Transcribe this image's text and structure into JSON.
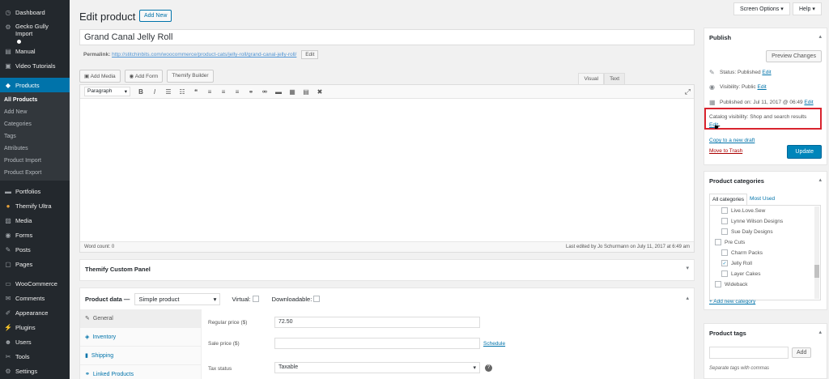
{
  "sidebar": {
    "items": [
      {
        "label": "Dashboard",
        "icon": "dashboard-icon",
        "glyph": "◷"
      },
      {
        "label": "Gecko Gully Import",
        "icon": "gear-icon",
        "glyph": "⚙"
      },
      {
        "label": "Manual",
        "icon": "book-icon",
        "glyph": "▤"
      },
      {
        "label": "Video Tutorials",
        "icon": "video-icon",
        "glyph": "▣"
      },
      {
        "label": "Products",
        "icon": "products-icon",
        "glyph": "◆"
      },
      {
        "label": "Portfolios",
        "icon": "portfolio-icon",
        "glyph": "▬"
      },
      {
        "label": "Themify Ultra",
        "icon": "themify-icon",
        "glyph": "●"
      },
      {
        "label": "Media",
        "icon": "media-icon",
        "glyph": "▨"
      },
      {
        "label": "Forms",
        "icon": "forms-icon",
        "glyph": "◉"
      },
      {
        "label": "Posts",
        "icon": "pin-icon",
        "glyph": "✎"
      },
      {
        "label": "Pages",
        "icon": "pages-icon",
        "glyph": "▢"
      },
      {
        "label": "WooCommerce",
        "icon": "woocommerce-icon",
        "glyph": "▭"
      },
      {
        "label": "Comments",
        "icon": "comments-icon",
        "glyph": "✉"
      },
      {
        "label": "Appearance",
        "icon": "appearance-icon",
        "glyph": "✐"
      },
      {
        "label": "Plugins",
        "icon": "plugins-icon",
        "glyph": "⚡"
      },
      {
        "label": "Users",
        "icon": "users-icon",
        "glyph": "☻"
      },
      {
        "label": "Tools",
        "icon": "tools-icon",
        "glyph": "✂"
      },
      {
        "label": "Settings",
        "icon": "settings-icon",
        "glyph": "⚙"
      }
    ],
    "submenu": [
      "All Products",
      "Add New",
      "Categories",
      "Tags",
      "Attributes",
      "Product Import",
      "Product Export"
    ]
  },
  "header": {
    "title": "Edit product",
    "add_new": "Add New",
    "screen_options": "Screen Options ▾",
    "help": "Help ▾"
  },
  "post": {
    "title": "Grand Canal Jelly Roll",
    "permalink_label": "Permalink:",
    "permalink_url": "http://stitchinbits.com/woocommerce/product-cats/jelly-roll/grand-canal-jelly-roll/",
    "permalink_edit": "Edit"
  },
  "editor": {
    "add_media": "Add Media",
    "add_form": "Add Form",
    "themify_builder": "Themify Builder",
    "tab_visual": "Visual",
    "tab_text": "Text",
    "format": "Paragraph",
    "word_count": "Word count: 0",
    "last_edited": "Last edited by Jo Schurmann on July 11, 2017 at 6:49 am",
    "toolbar_icons": [
      {
        "name": "bold-icon",
        "glyph": "B"
      },
      {
        "name": "italic-icon",
        "glyph": "I"
      },
      {
        "name": "bullet-list-icon",
        "glyph": "☰"
      },
      {
        "name": "numbered-list-icon",
        "glyph": "☷"
      },
      {
        "name": "blockquote-icon",
        "glyph": "❝"
      },
      {
        "name": "align-left-icon",
        "glyph": "≡"
      },
      {
        "name": "align-center-icon",
        "glyph": "≡"
      },
      {
        "name": "align-right-icon",
        "glyph": "≡"
      },
      {
        "name": "link-icon",
        "glyph": "⚭"
      },
      {
        "name": "unlink-icon",
        "glyph": "⚮"
      },
      {
        "name": "read-more-icon",
        "glyph": "▬"
      },
      {
        "name": "toolbar-toggle-icon",
        "glyph": "▦"
      },
      {
        "name": "table-icon",
        "glyph": "▤"
      },
      {
        "name": "shortcode-icon",
        "glyph": "✖"
      }
    ]
  },
  "themify_panel": {
    "title": "Themify Custom Panel"
  },
  "product_data": {
    "title": "Product data —",
    "type": "Simple product",
    "virtual": "Virtual:",
    "downloadable": "Downloadable:",
    "tabs": [
      {
        "label": "General",
        "icon": "wrench-icon",
        "glyph": "🔧"
      },
      {
        "label": "Inventory",
        "icon": "inventory-icon",
        "glyph": "◈"
      },
      {
        "label": "Shipping",
        "icon": "truck-icon",
        "glyph": "▮"
      },
      {
        "label": "Linked Products",
        "icon": "link-icon",
        "glyph": "⚭"
      }
    ],
    "regular_price_label": "Regular price ($)",
    "regular_price": "72.50",
    "sale_price_label": "Sale price ($)",
    "sale_price": "",
    "schedule": "Schedule",
    "tax_status_label": "Tax status",
    "tax_status": "Taxable"
  },
  "publish": {
    "title": "Publish",
    "preview": "Preview Changes",
    "status": "Status: Published",
    "visibility": "Visibility: Public",
    "published_on": "Published on: Jul 11, 2017 @ 06:49",
    "edit": "Edit",
    "catalog_visibility": "Catalog visibility: Shop and search results",
    "copy_draft": "Copy to a new draft",
    "trash": "Move to Trash",
    "update": "Update"
  },
  "categories": {
    "title": "Product categories",
    "tab_all": "All categories",
    "tab_used": "Most Used",
    "items": [
      {
        "label": "Live.Love.Sew",
        "checked": false
      },
      {
        "label": "Lynne Wilson Designs",
        "checked": false
      },
      {
        "label": "Sue Daly Designs",
        "checked": false
      },
      {
        "label": "Pre Cuts",
        "checked": false
      },
      {
        "label": "Charm Packs",
        "checked": false
      },
      {
        "label": "Jelly Roll",
        "checked": true
      },
      {
        "label": "Layer Cakes",
        "checked": false
      },
      {
        "label": "Wideback",
        "checked": false
      }
    ],
    "add_new": "+ Add new category"
  },
  "tags": {
    "title": "Product tags",
    "add": "Add",
    "hint": "Separate tags with commas"
  }
}
